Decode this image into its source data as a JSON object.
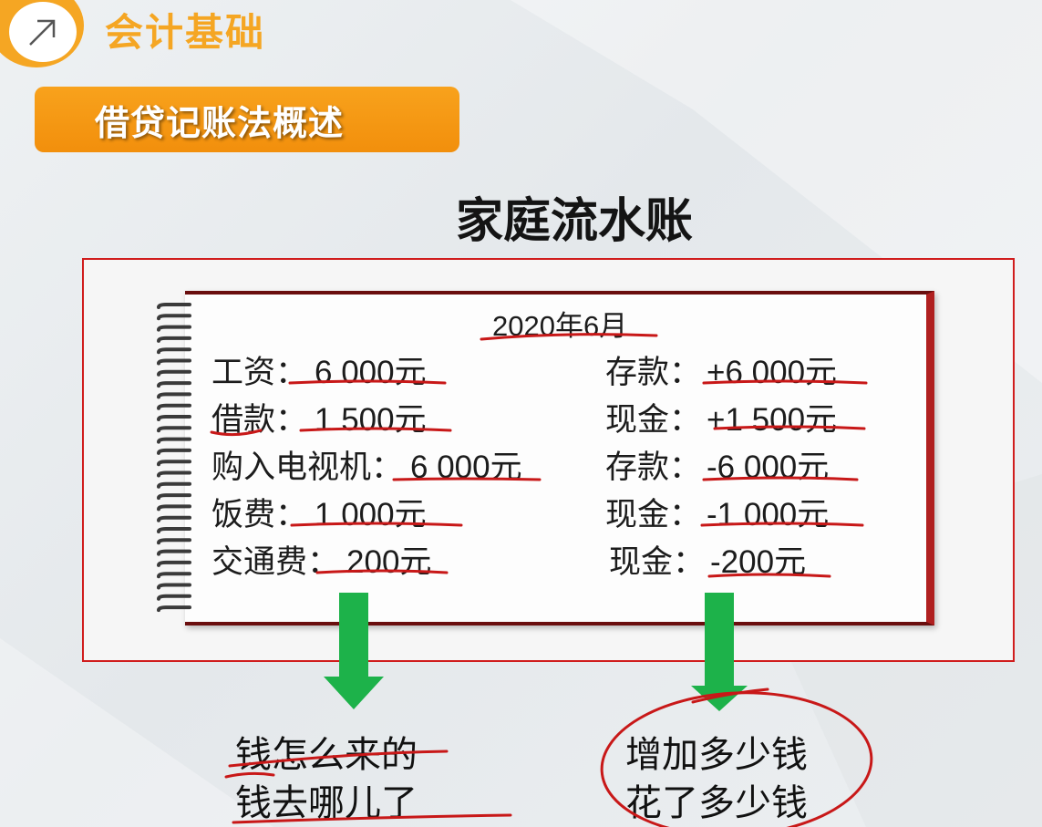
{
  "header": {
    "icon": "arrow-up-right-icon",
    "title": "会计基础"
  },
  "section": {
    "title": "借贷记账法概述"
  },
  "main_title": "家庭流水账",
  "ledger": {
    "date": "2020年6月",
    "left_rows": [
      {
        "label": "工资：",
        "value": "6 000元"
      },
      {
        "label": "借款：",
        "value": "1 500元"
      },
      {
        "label": "购入电视机：",
        "value": "6 000元"
      },
      {
        "label": "饭费：",
        "value": "1 000元"
      },
      {
        "label": "交通费：",
        "value": "200元"
      }
    ],
    "right_rows": [
      {
        "label": "存款：",
        "value": "+6 000元"
      },
      {
        "label": "现金：",
        "value": "+1 500元"
      },
      {
        "label": "存款：",
        "value": "-6 000元"
      },
      {
        "label": "现金：",
        "value": "-1 000元"
      },
      {
        "label": "现金：",
        "value": "-200元"
      }
    ]
  },
  "notes": {
    "left": [
      "钱怎么来的",
      "钱去哪儿了"
    ],
    "right": [
      "增加多少钱",
      "花了多少钱"
    ]
  },
  "colors": {
    "accent": "#f5a623",
    "banner": "#f39a14",
    "frame": "#d01d1d",
    "ink_red": "#c81818",
    "arrow_green": "#1db24a"
  }
}
